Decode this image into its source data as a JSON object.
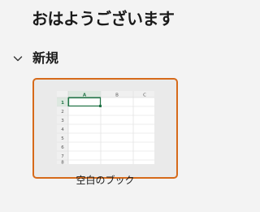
{
  "greeting": "おはようございます",
  "new_section": {
    "title": "新規",
    "expanded": true,
    "chevron_icon": "chevron-down-icon"
  },
  "templates": [
    {
      "label": "空白のブック",
      "selected": true,
      "column_headers": [
        "A",
        "B",
        "C"
      ],
      "row_headers": [
        "1",
        "2",
        "3",
        "4",
        "5",
        "6",
        "7",
        "8"
      ]
    }
  ],
  "colors": {
    "accent_border": "#d66a1a",
    "selected_cell": "#217346"
  }
}
